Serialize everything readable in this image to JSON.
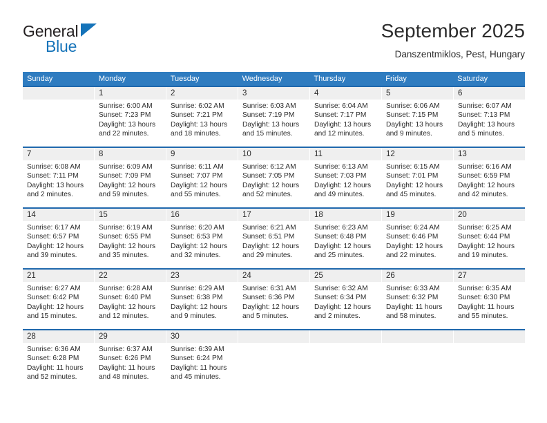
{
  "brand": {
    "word_one": "General",
    "word_two": "Blue",
    "accent_color": "#1573b9",
    "triangle_icon": "triangle-icon"
  },
  "header": {
    "title": "September 2025",
    "subtitle": "Danszentmiklos, Pest, Hungary"
  },
  "theme": {
    "header_bg": "#2f7cc0",
    "row_rule": "#1f68ad",
    "daynum_band": "#efefef",
    "text": "#2b2b2b"
  },
  "weekdays": [
    "Sunday",
    "Monday",
    "Tuesday",
    "Wednesday",
    "Thursday",
    "Friday",
    "Saturday"
  ],
  "weeks": [
    [
      {
        "day": "",
        "sunrise": "",
        "sunset": "",
        "daylight_a": "",
        "daylight_b": ""
      },
      {
        "day": "1",
        "sunrise": "Sunrise: 6:00 AM",
        "sunset": "Sunset: 7:23 PM",
        "daylight_a": "Daylight: 13 hours",
        "daylight_b": "and 22 minutes."
      },
      {
        "day": "2",
        "sunrise": "Sunrise: 6:02 AM",
        "sunset": "Sunset: 7:21 PM",
        "daylight_a": "Daylight: 13 hours",
        "daylight_b": "and 18 minutes."
      },
      {
        "day": "3",
        "sunrise": "Sunrise: 6:03 AM",
        "sunset": "Sunset: 7:19 PM",
        "daylight_a": "Daylight: 13 hours",
        "daylight_b": "and 15 minutes."
      },
      {
        "day": "4",
        "sunrise": "Sunrise: 6:04 AM",
        "sunset": "Sunset: 7:17 PM",
        "daylight_a": "Daylight: 13 hours",
        "daylight_b": "and 12 minutes."
      },
      {
        "day": "5",
        "sunrise": "Sunrise: 6:06 AM",
        "sunset": "Sunset: 7:15 PM",
        "daylight_a": "Daylight: 13 hours",
        "daylight_b": "and 9 minutes."
      },
      {
        "day": "6",
        "sunrise": "Sunrise: 6:07 AM",
        "sunset": "Sunset: 7:13 PM",
        "daylight_a": "Daylight: 13 hours",
        "daylight_b": "and 5 minutes."
      }
    ],
    [
      {
        "day": "7",
        "sunrise": "Sunrise: 6:08 AM",
        "sunset": "Sunset: 7:11 PM",
        "daylight_a": "Daylight: 13 hours",
        "daylight_b": "and 2 minutes."
      },
      {
        "day": "8",
        "sunrise": "Sunrise: 6:09 AM",
        "sunset": "Sunset: 7:09 PM",
        "daylight_a": "Daylight: 12 hours",
        "daylight_b": "and 59 minutes."
      },
      {
        "day": "9",
        "sunrise": "Sunrise: 6:11 AM",
        "sunset": "Sunset: 7:07 PM",
        "daylight_a": "Daylight: 12 hours",
        "daylight_b": "and 55 minutes."
      },
      {
        "day": "10",
        "sunrise": "Sunrise: 6:12 AM",
        "sunset": "Sunset: 7:05 PM",
        "daylight_a": "Daylight: 12 hours",
        "daylight_b": "and 52 minutes."
      },
      {
        "day": "11",
        "sunrise": "Sunrise: 6:13 AM",
        "sunset": "Sunset: 7:03 PM",
        "daylight_a": "Daylight: 12 hours",
        "daylight_b": "and 49 minutes."
      },
      {
        "day": "12",
        "sunrise": "Sunrise: 6:15 AM",
        "sunset": "Sunset: 7:01 PM",
        "daylight_a": "Daylight: 12 hours",
        "daylight_b": "and 45 minutes."
      },
      {
        "day": "13",
        "sunrise": "Sunrise: 6:16 AM",
        "sunset": "Sunset: 6:59 PM",
        "daylight_a": "Daylight: 12 hours",
        "daylight_b": "and 42 minutes."
      }
    ],
    [
      {
        "day": "14",
        "sunrise": "Sunrise: 6:17 AM",
        "sunset": "Sunset: 6:57 PM",
        "daylight_a": "Daylight: 12 hours",
        "daylight_b": "and 39 minutes."
      },
      {
        "day": "15",
        "sunrise": "Sunrise: 6:19 AM",
        "sunset": "Sunset: 6:55 PM",
        "daylight_a": "Daylight: 12 hours",
        "daylight_b": "and 35 minutes."
      },
      {
        "day": "16",
        "sunrise": "Sunrise: 6:20 AM",
        "sunset": "Sunset: 6:53 PM",
        "daylight_a": "Daylight: 12 hours",
        "daylight_b": "and 32 minutes."
      },
      {
        "day": "17",
        "sunrise": "Sunrise: 6:21 AM",
        "sunset": "Sunset: 6:51 PM",
        "daylight_a": "Daylight: 12 hours",
        "daylight_b": "and 29 minutes."
      },
      {
        "day": "18",
        "sunrise": "Sunrise: 6:23 AM",
        "sunset": "Sunset: 6:48 PM",
        "daylight_a": "Daylight: 12 hours",
        "daylight_b": "and 25 minutes."
      },
      {
        "day": "19",
        "sunrise": "Sunrise: 6:24 AM",
        "sunset": "Sunset: 6:46 PM",
        "daylight_a": "Daylight: 12 hours",
        "daylight_b": "and 22 minutes."
      },
      {
        "day": "20",
        "sunrise": "Sunrise: 6:25 AM",
        "sunset": "Sunset: 6:44 PM",
        "daylight_a": "Daylight: 12 hours",
        "daylight_b": "and 19 minutes."
      }
    ],
    [
      {
        "day": "21",
        "sunrise": "Sunrise: 6:27 AM",
        "sunset": "Sunset: 6:42 PM",
        "daylight_a": "Daylight: 12 hours",
        "daylight_b": "and 15 minutes."
      },
      {
        "day": "22",
        "sunrise": "Sunrise: 6:28 AM",
        "sunset": "Sunset: 6:40 PM",
        "daylight_a": "Daylight: 12 hours",
        "daylight_b": "and 12 minutes."
      },
      {
        "day": "23",
        "sunrise": "Sunrise: 6:29 AM",
        "sunset": "Sunset: 6:38 PM",
        "daylight_a": "Daylight: 12 hours",
        "daylight_b": "and 9 minutes."
      },
      {
        "day": "24",
        "sunrise": "Sunrise: 6:31 AM",
        "sunset": "Sunset: 6:36 PM",
        "daylight_a": "Daylight: 12 hours",
        "daylight_b": "and 5 minutes."
      },
      {
        "day": "25",
        "sunrise": "Sunrise: 6:32 AM",
        "sunset": "Sunset: 6:34 PM",
        "daylight_a": "Daylight: 12 hours",
        "daylight_b": "and 2 minutes."
      },
      {
        "day": "26",
        "sunrise": "Sunrise: 6:33 AM",
        "sunset": "Sunset: 6:32 PM",
        "daylight_a": "Daylight: 11 hours",
        "daylight_b": "and 58 minutes."
      },
      {
        "day": "27",
        "sunrise": "Sunrise: 6:35 AM",
        "sunset": "Sunset: 6:30 PM",
        "daylight_a": "Daylight: 11 hours",
        "daylight_b": "and 55 minutes."
      }
    ],
    [
      {
        "day": "28",
        "sunrise": "Sunrise: 6:36 AM",
        "sunset": "Sunset: 6:28 PM",
        "daylight_a": "Daylight: 11 hours",
        "daylight_b": "and 52 minutes."
      },
      {
        "day": "29",
        "sunrise": "Sunrise: 6:37 AM",
        "sunset": "Sunset: 6:26 PM",
        "daylight_a": "Daylight: 11 hours",
        "daylight_b": "and 48 minutes."
      },
      {
        "day": "30",
        "sunrise": "Sunrise: 6:39 AM",
        "sunset": "Sunset: 6:24 PM",
        "daylight_a": "Daylight: 11 hours",
        "daylight_b": "and 45 minutes."
      },
      {
        "day": "",
        "sunrise": "",
        "sunset": "",
        "daylight_a": "",
        "daylight_b": ""
      },
      {
        "day": "",
        "sunrise": "",
        "sunset": "",
        "daylight_a": "",
        "daylight_b": ""
      },
      {
        "day": "",
        "sunrise": "",
        "sunset": "",
        "daylight_a": "",
        "daylight_b": ""
      },
      {
        "day": "",
        "sunrise": "",
        "sunset": "",
        "daylight_a": "",
        "daylight_b": ""
      }
    ]
  ]
}
